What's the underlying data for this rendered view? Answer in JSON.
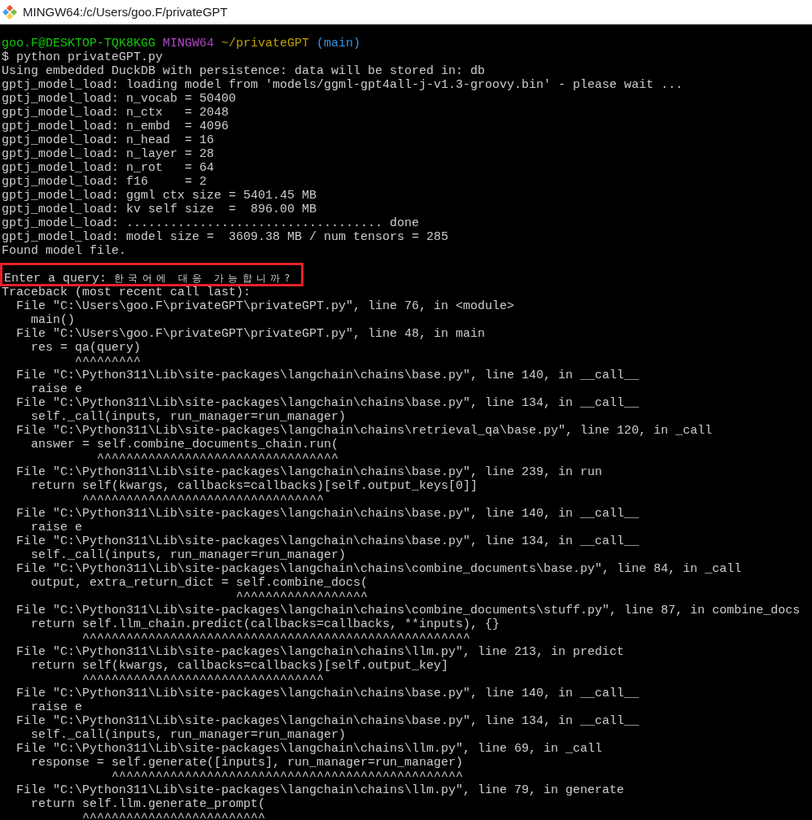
{
  "window": {
    "title": "MINGW64:/c/Users/goo.F/privateGPT"
  },
  "lines": [
    {
      "kind": "prompt",
      "segments": [
        {
          "text": "goo.F@DESKTOP-TQK8KGG",
          "color": "#16c60c"
        },
        {
          "text": "MINGW64",
          "color": "#b148c6"
        },
        {
          "text": "~/privateGPT",
          "color": "#c1a100"
        },
        {
          "text": "(main)",
          "color": "#3a96dd"
        }
      ]
    },
    {
      "kind": "text",
      "text": "$ python privateGPT.py"
    },
    {
      "kind": "text",
      "text": "Using embedded DuckDB with persistence: data will be stored in: db"
    },
    {
      "kind": "text",
      "text": "gptj_model_load: loading model from 'models/ggml-gpt4all-j-v1.3-groovy.bin' - please wait ..."
    },
    {
      "kind": "text",
      "text": "gptj_model_load: n_vocab = 50400"
    },
    {
      "kind": "text",
      "text": "gptj_model_load: n_ctx   = 2048"
    },
    {
      "kind": "text",
      "text": "gptj_model_load: n_embd  = 4096"
    },
    {
      "kind": "text",
      "text": "gptj_model_load: n_head  = 16"
    },
    {
      "kind": "text",
      "text": "gptj_model_load: n_layer = 28"
    },
    {
      "kind": "text",
      "text": "gptj_model_load: n_rot   = 64"
    },
    {
      "kind": "text",
      "text": "gptj_model_load: f16     = 2"
    },
    {
      "kind": "text",
      "text": "gptj_model_load: ggml ctx size = 5401.45 MB"
    },
    {
      "kind": "text",
      "text": "gptj_model_load: kv self size  =  896.00 MB"
    },
    {
      "kind": "text",
      "text": "gptj_model_load: ................................... done"
    },
    {
      "kind": "text",
      "text": "gptj_model_load: model size =  3609.38 MB / num tensors = 285"
    },
    {
      "kind": "text",
      "text": "Found model file."
    },
    {
      "kind": "blank"
    },
    {
      "kind": "query",
      "prompt": "Enter a query: ",
      "input": "한국어에 대응 가능합니까?",
      "highlighted": true
    },
    {
      "kind": "text",
      "text": "Traceback (most recent call last):"
    },
    {
      "kind": "text",
      "text": "  File \"C:\\Users\\goo.F\\privateGPT\\privateGPT.py\", line 76, in <module>"
    },
    {
      "kind": "text",
      "text": "    main()"
    },
    {
      "kind": "text",
      "text": "  File \"C:\\Users\\goo.F\\privateGPT\\privateGPT.py\", line 48, in main"
    },
    {
      "kind": "text",
      "text": "    res = qa(query)"
    },
    {
      "kind": "text",
      "text": "          ^^^^^^^^^"
    },
    {
      "kind": "text",
      "text": "  File \"C:\\Python311\\Lib\\site-packages\\langchain\\chains\\base.py\", line 140, in __call__"
    },
    {
      "kind": "text",
      "text": "    raise e"
    },
    {
      "kind": "text",
      "text": "  File \"C:\\Python311\\Lib\\site-packages\\langchain\\chains\\base.py\", line 134, in __call__"
    },
    {
      "kind": "text",
      "text": "    self._call(inputs, run_manager=run_manager)"
    },
    {
      "kind": "text",
      "text": "  File \"C:\\Python311\\Lib\\site-packages\\langchain\\chains\\retrieval_qa\\base.py\", line 120, in _call"
    },
    {
      "kind": "text",
      "text": "    answer = self.combine_documents_chain.run("
    },
    {
      "kind": "text",
      "text": "             ^^^^^^^^^^^^^^^^^^^^^^^^^^^^^^^^^"
    },
    {
      "kind": "text",
      "text": "  File \"C:\\Python311\\Lib\\site-packages\\langchain\\chains\\base.py\", line 239, in run"
    },
    {
      "kind": "text",
      "text": "    return self(kwargs, callbacks=callbacks)[self.output_keys[0]]"
    },
    {
      "kind": "text",
      "text": "           ^^^^^^^^^^^^^^^^^^^^^^^^^^^^^^^^^"
    },
    {
      "kind": "text",
      "text": "  File \"C:\\Python311\\Lib\\site-packages\\langchain\\chains\\base.py\", line 140, in __call__"
    },
    {
      "kind": "text",
      "text": "    raise e"
    },
    {
      "kind": "text",
      "text": "  File \"C:\\Python311\\Lib\\site-packages\\langchain\\chains\\base.py\", line 134, in __call__"
    },
    {
      "kind": "text",
      "text": "    self._call(inputs, run_manager=run_manager)"
    },
    {
      "kind": "text",
      "text": "  File \"C:\\Python311\\Lib\\site-packages\\langchain\\chains\\combine_documents\\base.py\", line 84, in _call"
    },
    {
      "kind": "text",
      "text": "    output, extra_return_dict = self.combine_docs("
    },
    {
      "kind": "text",
      "text": "                                ^^^^^^^^^^^^^^^^^^"
    },
    {
      "kind": "text",
      "text": "  File \"C:\\Python311\\Lib\\site-packages\\langchain\\chains\\combine_documents\\stuff.py\", line 87, in combine_docs"
    },
    {
      "kind": "text",
      "text": "    return self.llm_chain.predict(callbacks=callbacks, **inputs), {}"
    },
    {
      "kind": "text",
      "text": "           ^^^^^^^^^^^^^^^^^^^^^^^^^^^^^^^^^^^^^^^^^^^^^^^^^^^^^"
    },
    {
      "kind": "text",
      "text": "  File \"C:\\Python311\\Lib\\site-packages\\langchain\\chains\\llm.py\", line 213, in predict"
    },
    {
      "kind": "text",
      "text": "    return self(kwargs, callbacks=callbacks)[self.output_key]"
    },
    {
      "kind": "text",
      "text": "           ^^^^^^^^^^^^^^^^^^^^^^^^^^^^^^^^^"
    },
    {
      "kind": "text",
      "text": "  File \"C:\\Python311\\Lib\\site-packages\\langchain\\chains\\base.py\", line 140, in __call__"
    },
    {
      "kind": "text",
      "text": "    raise e"
    },
    {
      "kind": "text",
      "text": "  File \"C:\\Python311\\Lib\\site-packages\\langchain\\chains\\base.py\", line 134, in __call__"
    },
    {
      "kind": "text",
      "text": "    self._call(inputs, run_manager=run_manager)"
    },
    {
      "kind": "text",
      "text": "  File \"C:\\Python311\\Lib\\site-packages\\langchain\\chains\\llm.py\", line 69, in _call"
    },
    {
      "kind": "text",
      "text": "    response = self.generate([inputs], run_manager=run_manager)"
    },
    {
      "kind": "text",
      "text": "               ^^^^^^^^^^^^^^^^^^^^^^^^^^^^^^^^^^^^^^^^^^^^^^^^"
    },
    {
      "kind": "text",
      "text": "  File \"C:\\Python311\\Lib\\site-packages\\langchain\\chains\\llm.py\", line 79, in generate"
    },
    {
      "kind": "text",
      "text": "    return self.llm.generate_prompt("
    },
    {
      "kind": "text",
      "text": "           ^^^^^^^^^^^^^^^^^^^^^^^^^"
    }
  ]
}
